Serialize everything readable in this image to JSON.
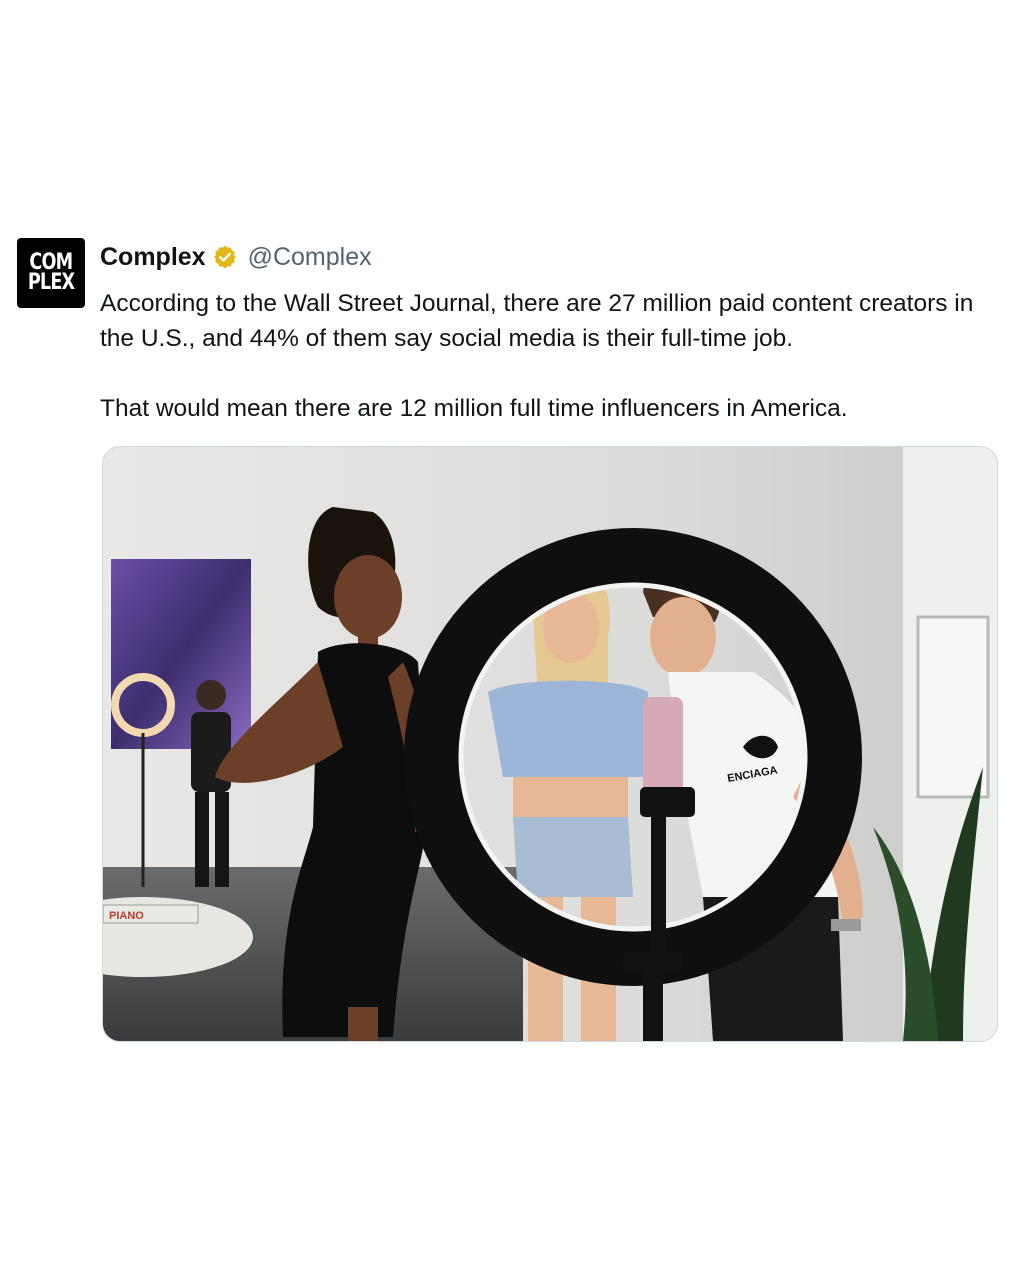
{
  "tweet": {
    "avatar_text_line1": "COM",
    "avatar_text_line2": "PLEX",
    "display_name": "Complex",
    "handle": "@Complex",
    "text_paragraph_1": "According to the Wall Street Journal, there are 27 million paid content creators in the U.S., and 44% of them say social media is their full-time job.",
    "text_paragraph_2": "That would mean there are 12 million full time influencers in America.",
    "verified_icon": "verified-badge-icon",
    "verified_color": "#e2b719"
  },
  "media": {
    "shirt_text": "ENCIAGA",
    "book_text": "PIANO"
  }
}
